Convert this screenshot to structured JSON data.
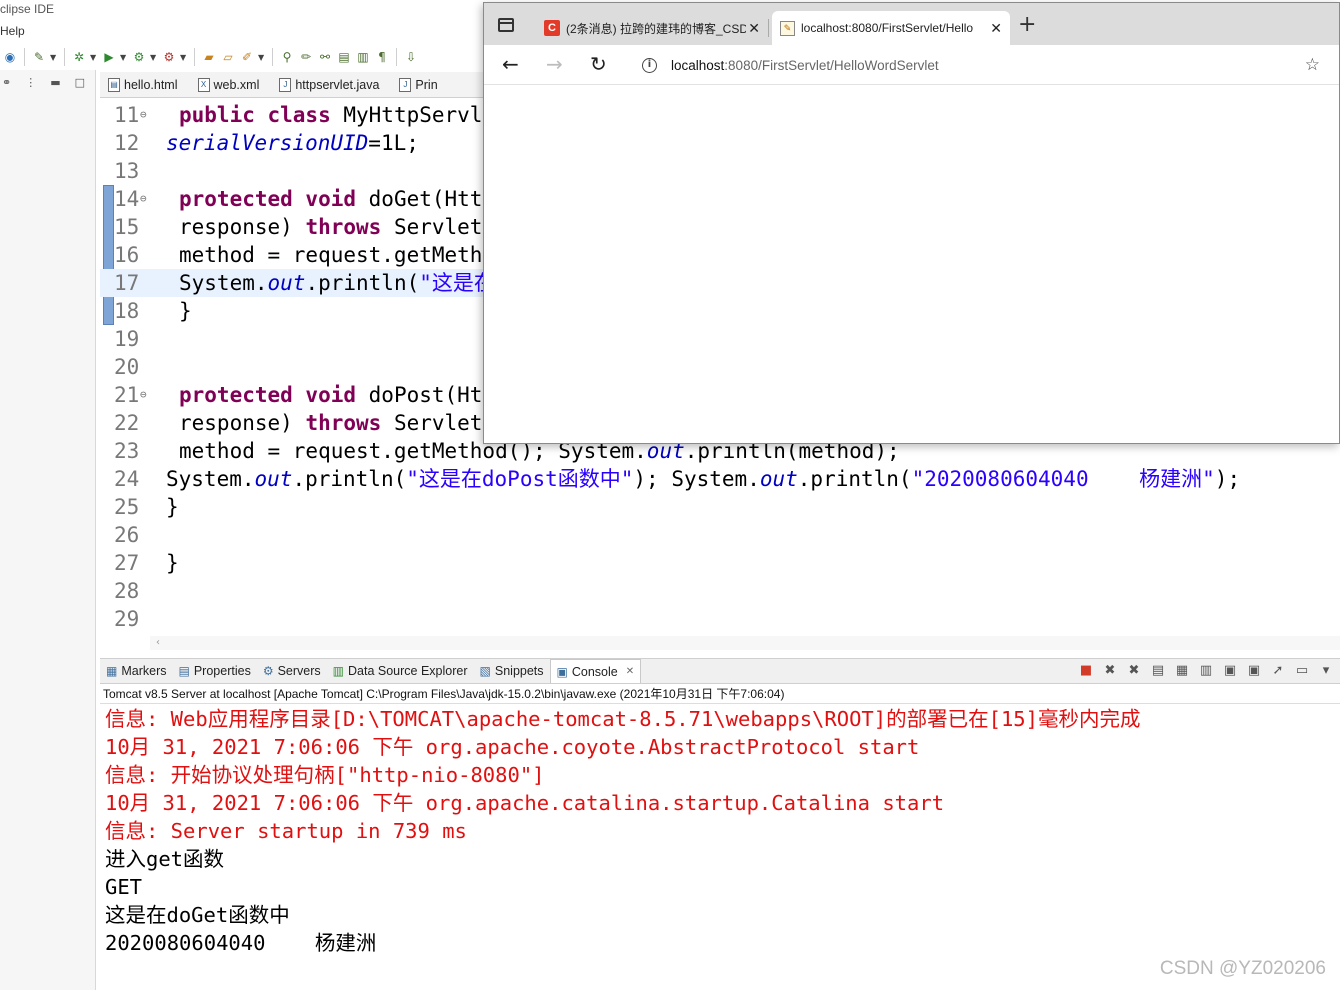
{
  "ide": {
    "title": "clipse IDE",
    "menu": "Help"
  },
  "editor_tabs": [
    {
      "label": "hello.html",
      "icon": "html-file-icon"
    },
    {
      "label": "web.xml",
      "icon": "xml-file-icon"
    },
    {
      "label": "httpservlet.java",
      "icon": "java-file-icon"
    },
    {
      "label": "Prin",
      "icon": "java-file-icon"
    }
  ],
  "code": {
    "lines": [
      {
        "n": "11",
        "fold": "⊖",
        "current": false,
        "seg": [
          {
            "t": "public class ",
            "c": "kw"
          },
          {
            "t": "MyHttpServl",
            "c": ""
          }
        ]
      },
      {
        "n": "12",
        "fold": "",
        "current": false,
        "indent": "nb",
        "seg": [
          {
            "t": "serialVersionUID",
            "c": "fld"
          },
          {
            "t": "=1L;",
            "c": ""
          }
        ]
      },
      {
        "n": "13",
        "fold": "",
        "current": false,
        "seg": []
      },
      {
        "n": "14",
        "fold": "⊖",
        "current": false,
        "seg": [
          {
            "t": "protected void ",
            "c": "kw"
          },
          {
            "t": "doGet(Htt",
            "c": ""
          }
        ]
      },
      {
        "n": "15",
        "fold": "",
        "current": false,
        "seg": [
          {
            "t": "response) ",
            "c": ""
          },
          {
            "t": "throws ",
            "c": "kw"
          },
          {
            "t": "Servlet",
            "c": ""
          }
        ]
      },
      {
        "n": "16",
        "fold": "",
        "current": false,
        "seg": [
          {
            "t": "method = request.getMeth",
            "c": ""
          }
        ]
      },
      {
        "n": "17",
        "fold": "",
        "current": true,
        "seg": [
          {
            "t": "System.",
            "c": ""
          },
          {
            "t": "out",
            "c": "fld"
          },
          {
            "t": ".println(",
            "c": ""
          },
          {
            "t": "\"这是在",
            "c": "str"
          }
        ]
      },
      {
        "n": "18",
        "fold": "",
        "current": false,
        "seg": [
          {
            "t": "}",
            "c": ""
          }
        ]
      },
      {
        "n": "19",
        "fold": "",
        "current": false,
        "seg": []
      },
      {
        "n": "20",
        "fold": "",
        "current": false,
        "seg": []
      },
      {
        "n": "21",
        "fold": "⊖",
        "current": false,
        "seg": [
          {
            "t": "protected void ",
            "c": "kw"
          },
          {
            "t": "doPost(Ht",
            "c": ""
          }
        ]
      },
      {
        "n": "22",
        "fold": "",
        "current": false,
        "seg": [
          {
            "t": "response) ",
            "c": ""
          },
          {
            "t": "throws ",
            "c": "kw"
          },
          {
            "t": "Servlet",
            "c": ""
          }
        ]
      },
      {
        "n": "23",
        "fold": "",
        "current": false,
        "seg": [
          {
            "t": "method = request.getMethod(); System.",
            "c": ""
          },
          {
            "t": "out",
            "c": "fld"
          },
          {
            "t": ".println(method);",
            "c": ""
          }
        ]
      },
      {
        "n": "24",
        "fold": "",
        "current": false,
        "indent": "nb",
        "seg": [
          {
            "t": "System.",
            "c": ""
          },
          {
            "t": "out",
            "c": "fld"
          },
          {
            "t": ".println(",
            "c": ""
          },
          {
            "t": "\"这是在doPost函数中\"",
            "c": "str"
          },
          {
            "t": "); System.",
            "c": ""
          },
          {
            "t": "out",
            "c": "fld"
          },
          {
            "t": ".println(",
            "c": ""
          },
          {
            "t": "\"2020080604040    杨建洲\"",
            "c": "str"
          },
          {
            "t": ");",
            "c": ""
          }
        ]
      },
      {
        "n": "25",
        "fold": "",
        "current": false,
        "indent": "nb",
        "seg": [
          {
            "t": "}",
            "c": ""
          }
        ]
      },
      {
        "n": "26",
        "fold": "",
        "current": false,
        "seg": []
      },
      {
        "n": "27",
        "fold": "",
        "current": false,
        "indent": "nb",
        "seg": [
          {
            "t": "}",
            "c": ""
          }
        ]
      },
      {
        "n": "28",
        "fold": "",
        "current": false,
        "seg": []
      },
      {
        "n": "29",
        "fold": "",
        "current": false,
        "seg": []
      }
    ]
  },
  "views": {
    "tabs": [
      {
        "label": "Markers",
        "icon": "markers-icon",
        "active": false
      },
      {
        "label": "Properties",
        "icon": "properties-icon",
        "active": false
      },
      {
        "label": "Servers",
        "icon": "servers-icon",
        "active": false
      },
      {
        "label": "Data Source Explorer",
        "icon": "data-source-icon",
        "active": false
      },
      {
        "label": "Snippets",
        "icon": "snippets-icon",
        "active": false
      },
      {
        "label": "Console",
        "icon": "console-icon",
        "active": true
      }
    ]
  },
  "console": {
    "header": "Tomcat v8.5 Server at localhost [Apache Tomcat] C:\\Program Files\\Java\\jdk-15.0.2\\bin\\javaw.exe  (2021年10月31日 下午7:06:04)",
    "lines": [
      {
        "text": "信息: Web应用程序目录[D:\\TOMCAT\\apache-tomcat-8.5.71\\webapps\\ROOT]的部署已在[15]毫秒内完成",
        "err": true
      },
      {
        "text": "10月 31, 2021 7:06:06 下午 org.apache.coyote.AbstractProtocol start",
        "err": true
      },
      {
        "text": "信息: 开始协议处理句柄[\"http-nio-8080\"]",
        "err": true
      },
      {
        "text": "10月 31, 2021 7:06:06 下午 org.apache.catalina.startup.Catalina start",
        "err": true
      },
      {
        "text": "信息: Server startup in 739 ms",
        "err": true
      },
      {
        "text": "进入get函数",
        "err": false
      },
      {
        "text": "GET",
        "err": false
      },
      {
        "text": "这是在doGet函数中",
        "err": false
      },
      {
        "text": "2020080604040    杨建洲",
        "err": false
      }
    ]
  },
  "watermark": "CSDN @YZ020206",
  "browser": {
    "tabs": [
      {
        "title": "(2条消息) 拉跨的建玮的博客_CSD",
        "favicon": "csdn-favicon",
        "favicon_letter": "C",
        "active": false
      },
      {
        "title": "localhost:8080/FirstServlet/Hello",
        "favicon": "page-favicon",
        "active": true
      }
    ],
    "url_host": "localhost",
    "url_path": ":8080/FirstServlet/HelloWordServlet"
  }
}
